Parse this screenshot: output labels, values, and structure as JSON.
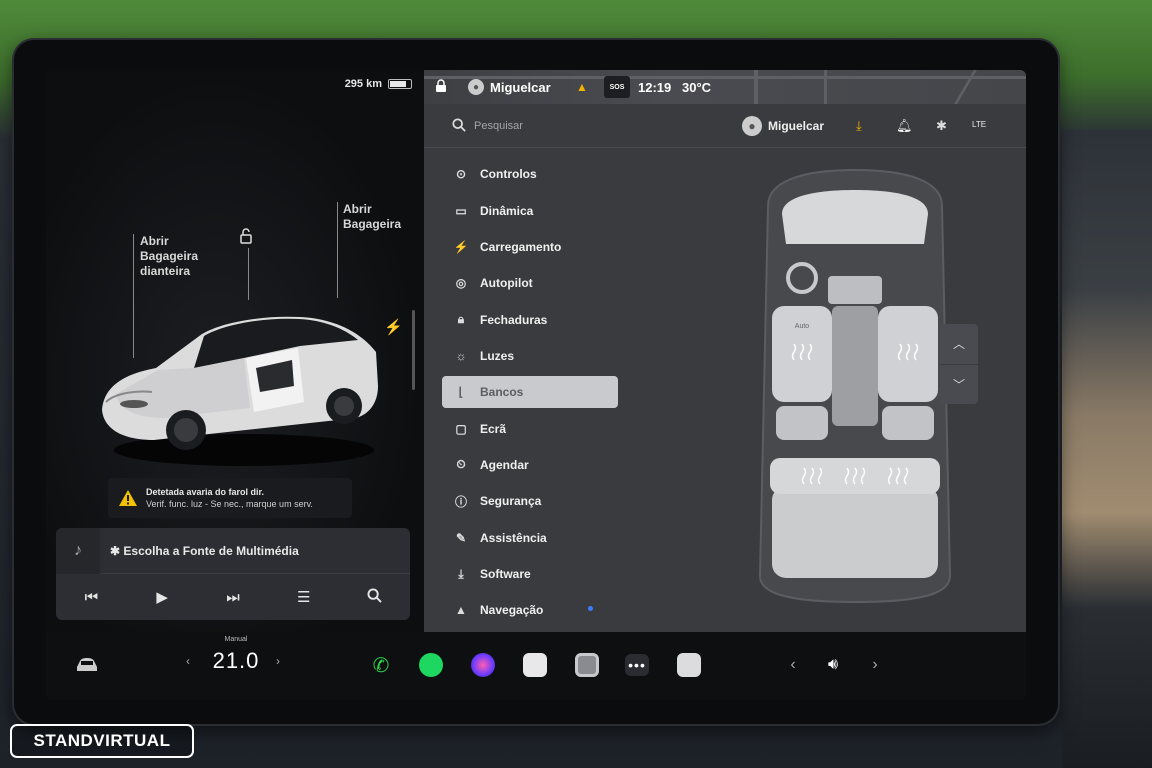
{
  "left_panel": {
    "range": "295 km",
    "battery_level": 0.8,
    "front_trunk_label": [
      "Abrir",
      "Bagageira",
      "dianteira"
    ],
    "rear_trunk_label": [
      "Abrir",
      "Bagageira"
    ],
    "alert": {
      "title": "Detetada avaria do farol dir.",
      "detail": "Verif. func. luz - Se nec., marque um serv."
    },
    "media": {
      "source_label": "✱ Escolha a Fonte de Multimédia"
    }
  },
  "status_bar": {
    "user": "Miguelcar",
    "sos": "SOS",
    "time": "12:19",
    "temperature": "30°C"
  },
  "top_row": {
    "search_placeholder": "Pesquisar",
    "user": "Miguelcar",
    "signal": "LTE"
  },
  "menu": [
    {
      "label": "Controlos",
      "icon": "toggle-icon",
      "active": false
    },
    {
      "label": "Dinâmica",
      "icon": "car-icon",
      "active": false
    },
    {
      "label": "Carregamento",
      "icon": "bolt-icon",
      "active": false
    },
    {
      "label": "Autopilot",
      "icon": "steering-wheel-icon",
      "active": false
    },
    {
      "label": "Fechaduras",
      "icon": "lock-icon",
      "active": false
    },
    {
      "label": "Luzes",
      "icon": "sun-icon",
      "active": false
    },
    {
      "label": "Bancos",
      "icon": "seat-icon",
      "active": true
    },
    {
      "label": "Ecrã",
      "icon": "display-icon",
      "active": false
    },
    {
      "label": "Agendar",
      "icon": "clock-icon",
      "active": false
    },
    {
      "label": "Segurança",
      "icon": "shield-icon",
      "active": false
    },
    {
      "label": "Assistência",
      "icon": "wrench-icon",
      "active": false
    },
    {
      "label": "Software",
      "icon": "download-icon",
      "active": false
    },
    {
      "label": "Navegação",
      "icon": "navigation-icon",
      "active": false
    }
  ],
  "seat_view": {
    "driver_seat_label": "Auto"
  },
  "dock": {
    "climate_mode": "Manual",
    "temperature": "21.0"
  },
  "watermark": "STANDVIRTUAL"
}
